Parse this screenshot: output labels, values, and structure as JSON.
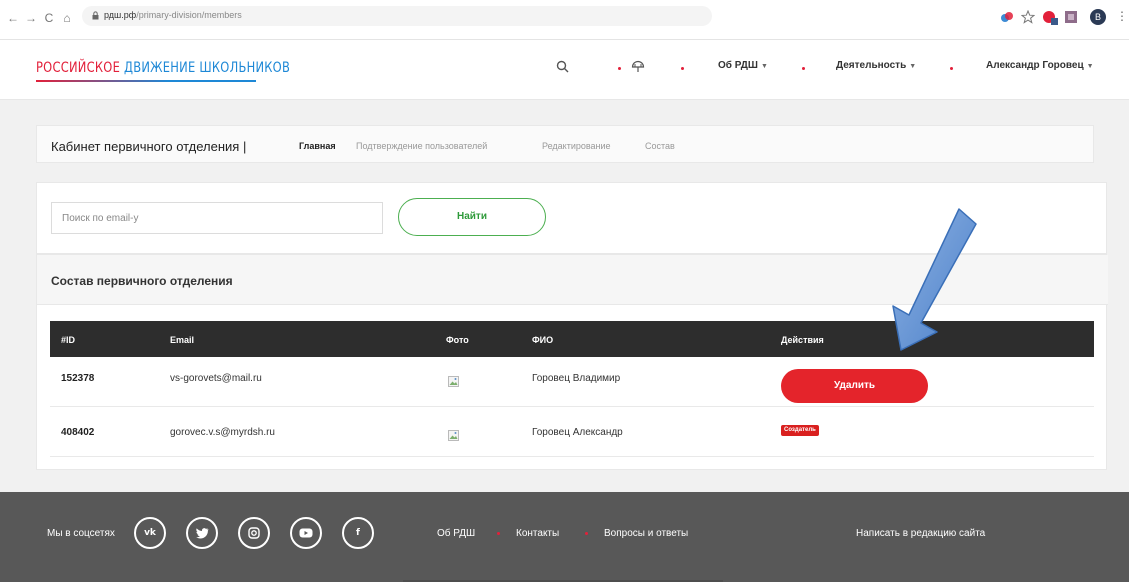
{
  "browser": {
    "nav": {
      "back": "←",
      "forward": "→",
      "reload": "C",
      "home": "⌂"
    },
    "url_host": "рдш.рф",
    "url_path": "/primary-division/members",
    "profile_initial": "B"
  },
  "header": {
    "logo_red": "РОССИЙСКОЕ ",
    "logo_blue": "ДВИЖЕНИЕ ШКОЛЬНИКОВ",
    "menu": {
      "about": "Об РДШ",
      "activity": "Деятельность",
      "user": "Александр Горовец"
    },
    "colors": {
      "brand_red": "#e2203a",
      "brand_blue": "#1e88d6"
    }
  },
  "breadcrumb": {
    "title": "Кабинет первичного отделения |",
    "links": [
      "Главная",
      "Подтверждение пользователей",
      "Редактирование",
      "Состав"
    ]
  },
  "search": {
    "placeholder": "Поиск по email-у",
    "button": "Найти"
  },
  "members": {
    "title": "Состав первичного отделения",
    "columns": [
      "#ID",
      "Email",
      "Фото",
      "ФИО",
      "Действия"
    ],
    "rows": [
      {
        "id": "152378",
        "email": "vs-gorovets@mail.ru",
        "name": "Горовец Владимир",
        "action": "Удалить"
      },
      {
        "id": "408402",
        "email": "gorovec.v.s@myrdsh.ru",
        "name": "Горовец Александр",
        "badge": "Создатель"
      }
    ]
  },
  "footer": {
    "social_label": "Мы в соцсетях",
    "social": [
      {
        "name": "vk-icon",
        "glyph": "vk"
      },
      {
        "name": "twitter-icon",
        "glyph": "t"
      },
      {
        "name": "instagram-icon",
        "glyph": "◘"
      },
      {
        "name": "youtube-icon",
        "glyph": "▶"
      },
      {
        "name": "facebook-icon",
        "glyph": "f"
      }
    ],
    "links": [
      "Об РДШ",
      "Контакты",
      "Вопросы и ответы"
    ],
    "write": "Написать в редакцию сайта"
  }
}
